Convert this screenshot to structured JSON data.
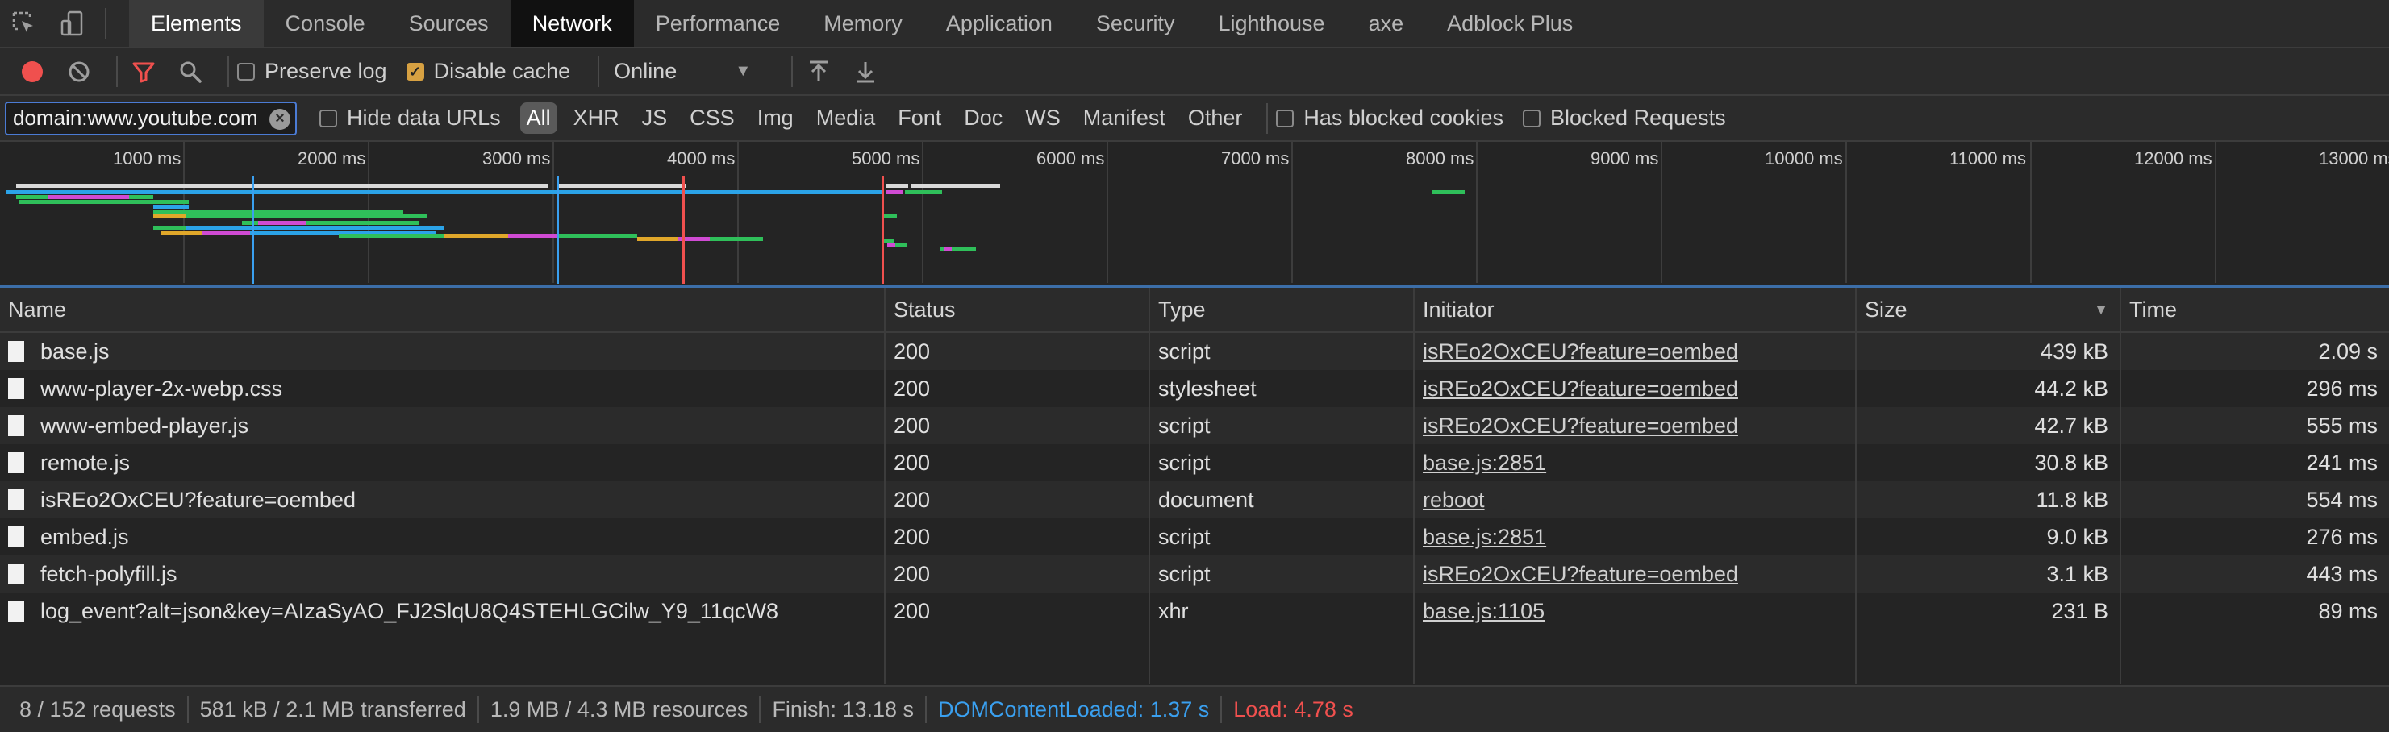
{
  "tabs": [
    "Elements",
    "Console",
    "Sources",
    "Network",
    "Performance",
    "Memory",
    "Application",
    "Security",
    "Lighthouse",
    "axe",
    "Adblock Plus"
  ],
  "toolbar": {
    "preserve_log": "Preserve log",
    "disable_cache": "Disable cache",
    "throttling": "Online"
  },
  "filter": {
    "value": "domain:www.youtube.com",
    "hide_data_urls": "Hide data URLs",
    "types": [
      "All",
      "XHR",
      "JS",
      "CSS",
      "Img",
      "Media",
      "Font",
      "Doc",
      "WS",
      "Manifest",
      "Other"
    ],
    "has_blocked_cookies": "Has blocked cookies",
    "blocked_requests": "Blocked Requests"
  },
  "overview": {
    "ticks": [
      "1000 ms",
      "2000 ms",
      "3000 ms",
      "4000 ms",
      "5000 ms",
      "6000 ms",
      "7000 ms",
      "8000 ms",
      "9000 ms",
      "10000 ms",
      "11000 ms",
      "12000 ms",
      "13000 ms"
    ]
  },
  "table": {
    "headers": {
      "name": "Name",
      "status": "Status",
      "type": "Type",
      "initiator": "Initiator",
      "size": "Size",
      "time": "Time"
    },
    "rows": [
      {
        "name": "base.js",
        "status": "200",
        "type": "script",
        "initiator": "isREo2OxCEU?feature=oembed",
        "size": "439 kB",
        "time": "2.09 s"
      },
      {
        "name": "www-player-2x-webp.css",
        "status": "200",
        "type": "stylesheet",
        "initiator": "isREo2OxCEU?feature=oembed",
        "size": "44.2 kB",
        "time": "296 ms"
      },
      {
        "name": "www-embed-player.js",
        "status": "200",
        "type": "script",
        "initiator": "isREo2OxCEU?feature=oembed",
        "size": "42.7 kB",
        "time": "555 ms"
      },
      {
        "name": "remote.js",
        "status": "200",
        "type": "script",
        "initiator": "base.js:2851",
        "size": "30.8 kB",
        "time": "241 ms"
      },
      {
        "name": "isREo2OxCEU?feature=oembed",
        "status": "200",
        "type": "document",
        "initiator": "reboot",
        "size": "11.8 kB",
        "time": "554 ms"
      },
      {
        "name": "embed.js",
        "status": "200",
        "type": "script",
        "initiator": "base.js:2851",
        "size": "9.0 kB",
        "time": "276 ms"
      },
      {
        "name": "fetch-polyfill.js",
        "status": "200",
        "type": "script",
        "initiator": "isREo2OxCEU?feature=oembed",
        "size": "3.1 kB",
        "time": "443 ms"
      },
      {
        "name": "log_event?alt=json&key=AIzaSyAO_FJ2SlqU8Q4STEHLGCilw_Y9_11qcW8",
        "status": "200",
        "type": "xhr",
        "initiator": "base.js:1105",
        "size": "231 B",
        "time": "89 ms"
      }
    ]
  },
  "status": {
    "requests": "8 / 152 requests",
    "transferred": "581 kB / 2.1 MB transferred",
    "resources": "1.9 MB / 4.3 MB resources",
    "finish": "Finish: 13.18 s",
    "dom_content_loaded": "DOMContentLoaded: 1.37 s",
    "load": "Load: 4.78 s"
  },
  "colors": {
    "accent": "#4b7bd4",
    "dcl": "#3aa0f0",
    "load": "#f0504e",
    "record": "#f0504e",
    "filter_active": "#f0504e",
    "checkbox_on": "#d7a142"
  }
}
